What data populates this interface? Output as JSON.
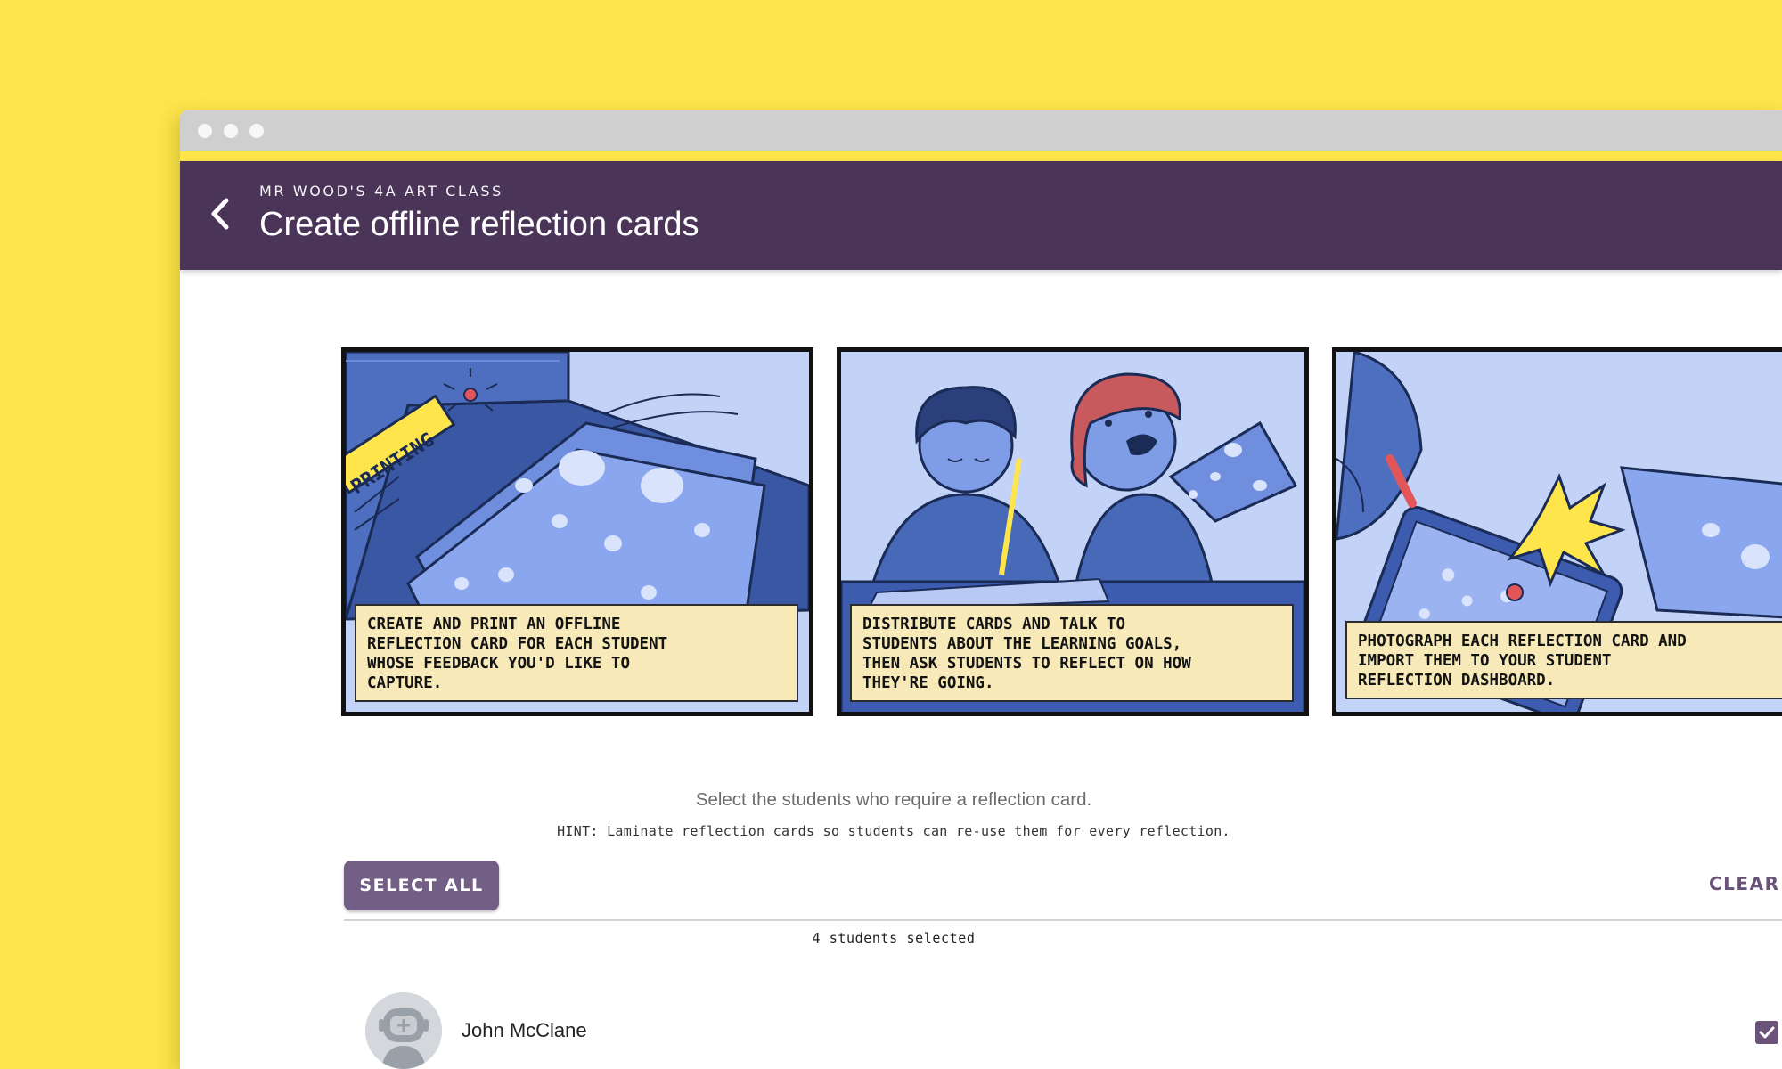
{
  "app": {
    "class_name": "MR WOOD'S 4A ART CLASS",
    "page_title": "Create offline reflection cards"
  },
  "panels": [
    {
      "caption": "Create and print an offline\nreflection card for each student\nwhose feedback you'd like to\ncapture.",
      "sign": "PRINTING"
    },
    {
      "caption": "Distribute cards and talk to\nstudents about the learning goals,\nthen ask students to reflect on how\nthey're going."
    },
    {
      "caption": "Photograph each reflection card and\nimport them to your student\nreflection dashboard."
    }
  ],
  "instructions": "Select the students who require a reflection card.",
  "hint": "HINT: Laminate reflection cards so students can re-use them for every reflection.",
  "actions": {
    "select_all": "SELECT ALL",
    "clear": "CLEAR"
  },
  "selected_count": "4 students selected",
  "students": [
    {
      "name": "John McClane",
      "selected": true
    }
  ],
  "colors": {
    "background": "#fde54b",
    "header": "#4a3458",
    "accent": "#735e85",
    "caption_bg": "#f7e9b8"
  }
}
